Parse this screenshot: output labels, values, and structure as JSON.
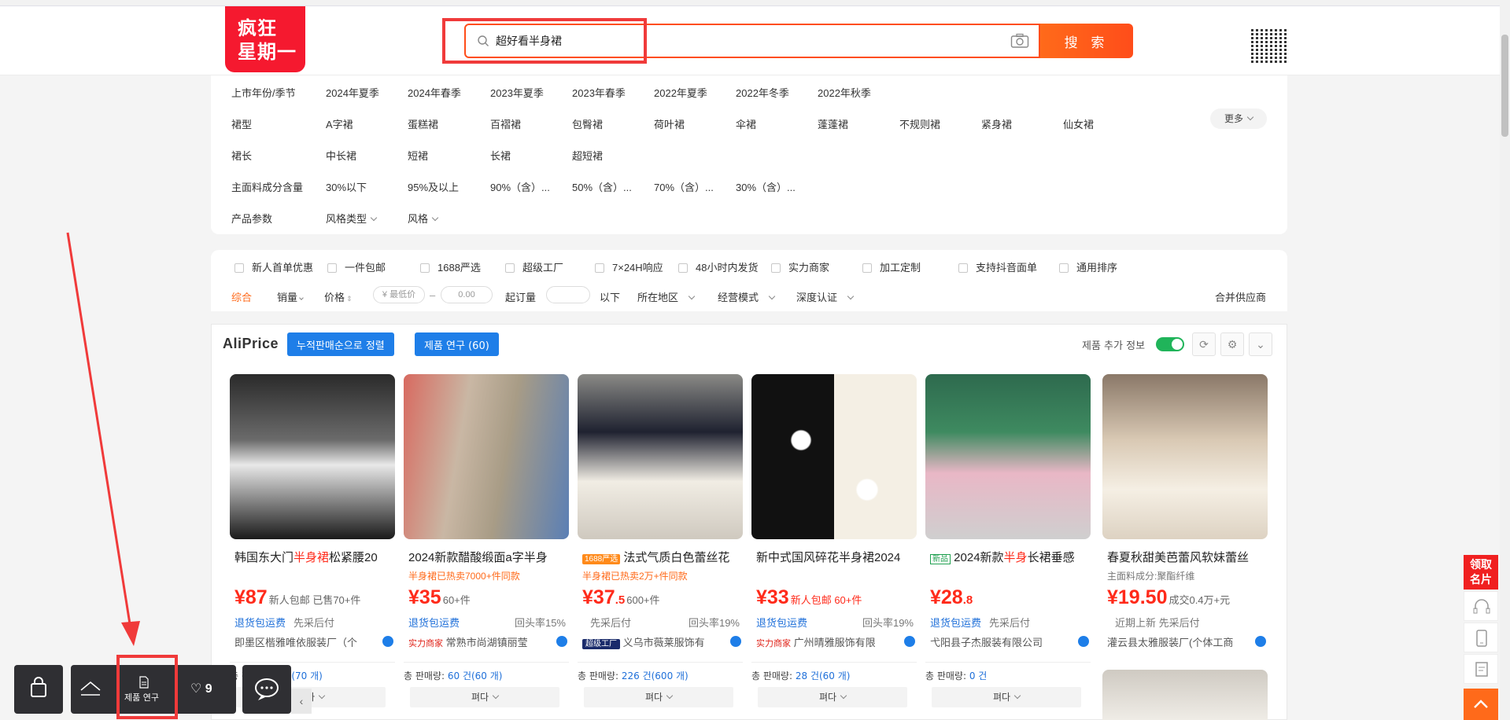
{
  "header": {
    "logo_line1": "疯狂",
    "logo_line2": "星期一",
    "search_value": "超好看半身裙",
    "search_button": "搜 索"
  },
  "filters": {
    "rows": [
      {
        "label": "上市年份/季节",
        "items": [
          "2024年夏季",
          "2024年春季",
          "2023年夏季",
          "2023年春季",
          "2022年夏季",
          "2022年冬季",
          "2022年秋季"
        ]
      },
      {
        "label": "裙型",
        "items": [
          "A字裙",
          "蛋糕裙",
          "百褶裙",
          "包臀裙",
          "荷叶裙",
          "伞裙",
          "蓬蓬裙",
          "不规则裙",
          "紧身裙",
          "仙女裙"
        ]
      },
      {
        "label": "裙长",
        "items": [
          "中长裙",
          "短裙",
          "长裙",
          "超短裙"
        ]
      },
      {
        "label": "主面料成分含量",
        "items": [
          "30%以下",
          "95%及以上",
          "90%（含）...",
          "50%（含）...",
          "70%（含）...",
          "30%（含）..."
        ]
      },
      {
        "label": "产品参数",
        "items": [
          "风格类型",
          "风格"
        ]
      }
    ],
    "more_label": "更多"
  },
  "sort": {
    "checks": [
      "新人首单优惠",
      "一件包邮",
      "1688严选",
      "超级工厂",
      "7×24H响应",
      "48小时内发货",
      "实力商家",
      "加工定制",
      "支持抖音面单",
      "通用排序"
    ],
    "items": [
      "综合",
      "销量",
      "价格"
    ],
    "price_min_placeholder": "¥ 最低价",
    "price_dash": "–",
    "price_max_placeholder": "0.00",
    "moq_label": "起订量",
    "moq_suffix": "以下",
    "region": "所在地区",
    "mode": "经营模式",
    "cert": "深度认证",
    "merge": "合并供应商"
  },
  "aliprice": {
    "logo": "AliPrice",
    "btn_sort": "누적판매순으로 정렬",
    "btn_research": "제품 연구 (60)",
    "extra_info": "제품 추가 정보"
  },
  "products": [
    {
      "title_pre": "韩国东大门",
      "title_hl": "半身裙",
      "title_post": "松紧腰20",
      "sub": "",
      "price_int": "87",
      "price_dec": "",
      "price_extra": "新人包邮 已售70+件",
      "svc1": "退货包运费",
      "svc2": "先采后付",
      "svc_right": "",
      "shop_tag": "",
      "shop": "即墨区楷雅唯依服装厂（个",
      "sales_label": "총 판매량:",
      "sales_value": "7 건(70 개)",
      "expand": "펴다"
    },
    {
      "title_pre": "2024新款醋酸缎面a字半身",
      "title_hl": "",
      "title_post": "",
      "sub": "半身裙已热卖7000+件同款",
      "price_int": "35",
      "price_dec": "",
      "price_extra": "60+件",
      "svc1": "退货包运费",
      "svc2": "",
      "svc_right": "回头率15%",
      "shop_tag": "实力商家",
      "shop": "常熟市尚湖镇丽莹",
      "sales_label": "총 판매량:",
      "sales_value": "60 건(60 개)",
      "expand": "펴다"
    },
    {
      "title_pre": "法式气质白色蕾丝花",
      "title_hl": "",
      "title_post": "",
      "title_tag": "1688严选",
      "sub": "半身裙已热卖2万+件同款",
      "price_int": "37",
      "price_dec": ".5",
      "price_extra": "600+件",
      "svc1": "",
      "svc2": "先采后付",
      "svc_right": "回头率19%",
      "shop_tag": "超级工厂",
      "shop": "义乌市薇莱服饰有",
      "sales_label": "총 판매량:",
      "sales_value": "226 건(600 개)",
      "expand": "펴다"
    },
    {
      "title_pre": "新中式国风碎花半身裙2024",
      "title_hl": "",
      "title_post": "",
      "sub": "",
      "price_int": "33",
      "price_dec": "",
      "price_extra": "新人包邮 60+件",
      "svc1": "退货包运费",
      "svc2": "",
      "svc_right": "回头率19%",
      "shop_tag": "实力商家",
      "shop": "广州晴雅服饰有限",
      "sales_label": "총 판매량:",
      "sales_value": "28 건(60 개)",
      "expand": "펴다"
    },
    {
      "title_pre": "2024新款",
      "title_hl": "半身",
      "title_post": "长裙垂感",
      "title_tag": "新品",
      "sub": "",
      "price_int": "28",
      "price_dec": ".8",
      "price_extra": "",
      "svc1": "退货包运费",
      "svc2": "先采后付",
      "svc_right": "",
      "shop_tag": "",
      "shop": "弋阳县子杰服装有限公司",
      "sales_label": "총 판매량:",
      "sales_value": "0 건",
      "expand": "펴다"
    },
    {
      "title_pre": "春夏秋甜美芭蕾风软妹蕾丝",
      "title_hl": "",
      "title_post": "",
      "sub": "主面料成分:聚酯纤维",
      "price_int": "19.50",
      "price_dec": "",
      "price_extra": "成交0.4万+元",
      "svc1": "",
      "svc2": "近期上新  先采后付",
      "svc_right": "",
      "shop_tag": "",
      "shop": "灌云县太雅服装厂(个体工商",
      "sales_label": "",
      "sales_value": "",
      "expand": ""
    }
  ],
  "bottom_toolbar": {
    "research_label": "제품 연구",
    "fav_count": "9"
  },
  "right_rail": {
    "card_line1": "领取",
    "card_line2": "名片"
  }
}
